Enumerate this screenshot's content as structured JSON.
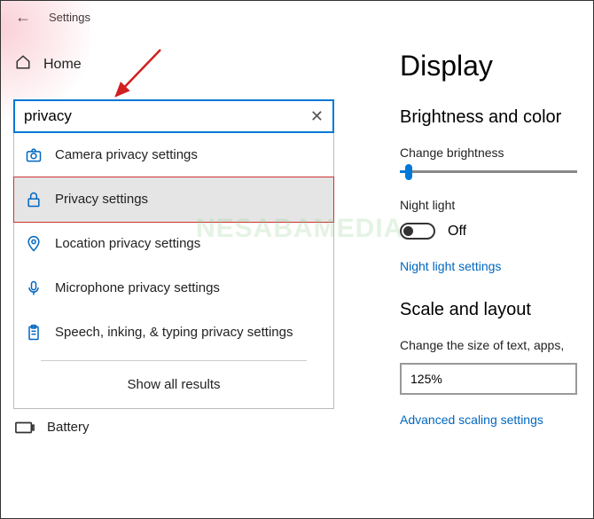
{
  "titlebar": {
    "title": "Settings"
  },
  "home": {
    "label": "Home"
  },
  "search": {
    "value": "privacy"
  },
  "suggestions": [
    {
      "icon": "camera",
      "label": "Camera privacy settings",
      "hl": false
    },
    {
      "icon": "lock",
      "label": "Privacy settings",
      "hl": true
    },
    {
      "icon": "location",
      "label": "Location privacy settings",
      "hl": false
    },
    {
      "icon": "mic",
      "label": "Microphone privacy settings",
      "hl": false
    },
    {
      "icon": "clipboard",
      "label": "Speech, inking, & typing privacy settings",
      "hl": false
    }
  ],
  "show_all": "Show all results",
  "battery": {
    "label": "Battery"
  },
  "right": {
    "heading": "Display",
    "section1": "Brightness and color",
    "brightness_label": "Change brightness",
    "night_light_label": "Night light",
    "night_light_state": "Off",
    "night_light_link": "Night light settings",
    "section2": "Scale and layout",
    "scale_label": "Change the size of text, apps,",
    "scale_value": "125%",
    "adv_link": "Advanced scaling settings"
  },
  "watermark": "NESABAMEDIA"
}
